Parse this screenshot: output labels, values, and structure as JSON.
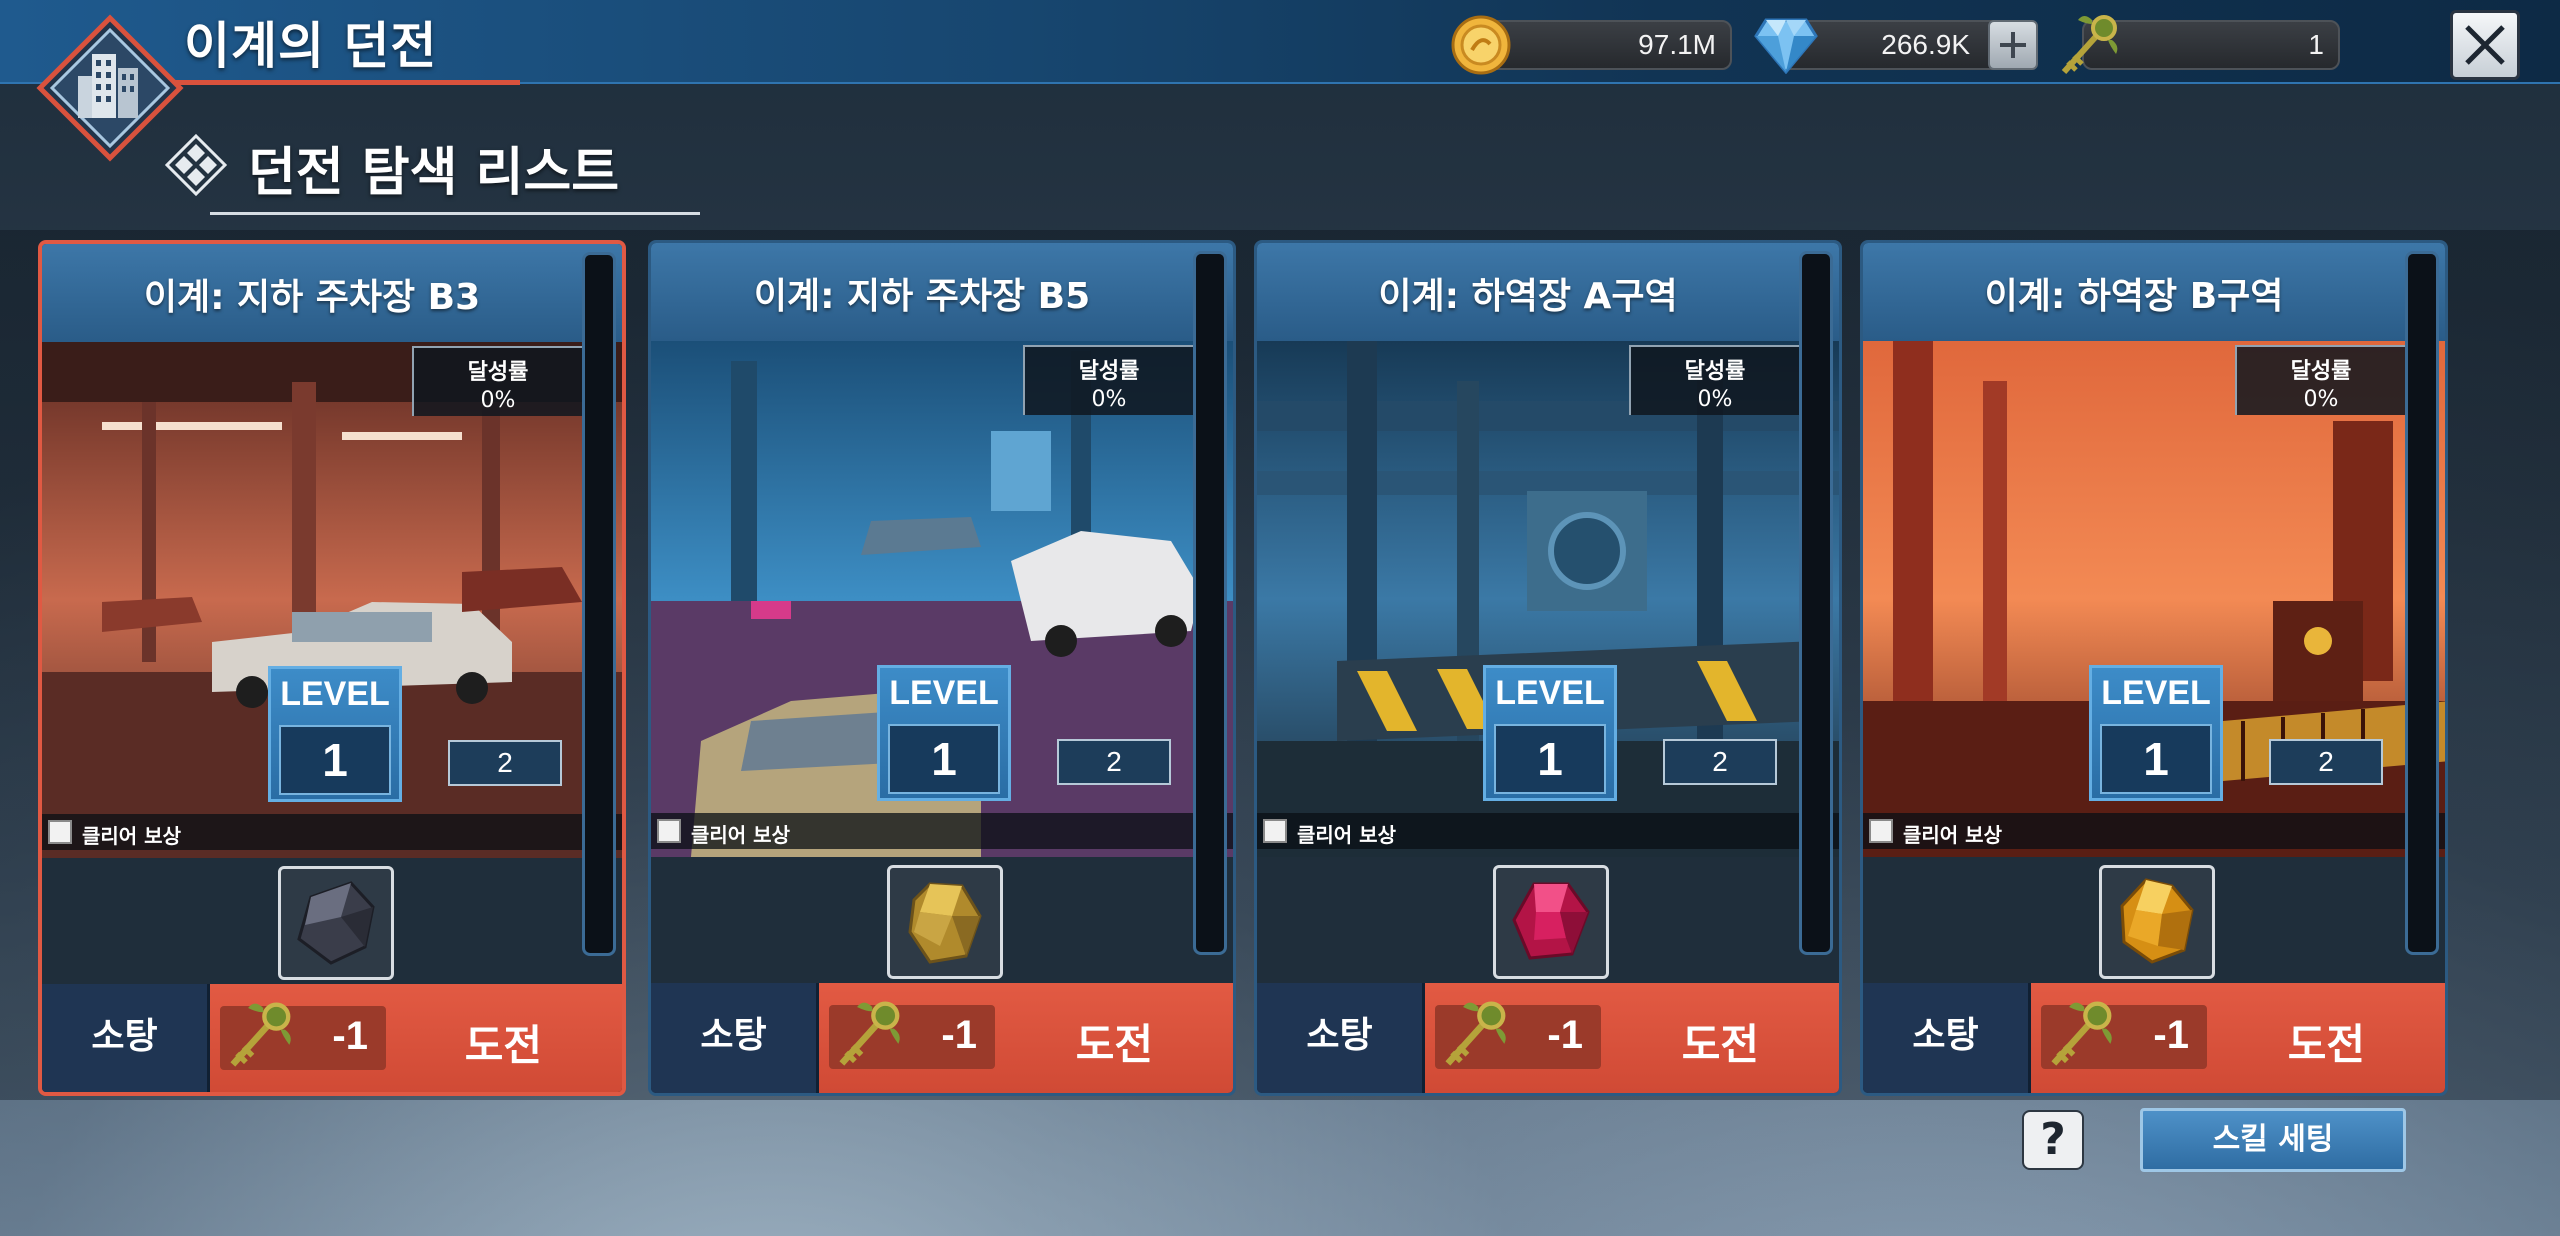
{
  "header": {
    "title": "이계의 던전",
    "subtitle": "던전 탐색 리스트"
  },
  "currencies": {
    "gold": "97.1M",
    "gems": "266.9K",
    "keys": "1"
  },
  "cards": [
    {
      "title": "이계: 지하 주차장 B3",
      "progress_label": "달성률",
      "progress_value": "0%",
      "level_label": "LEVEL",
      "level": "1",
      "next_level": "2",
      "reward_label": "클리어 보상",
      "sweep_label": "소탕",
      "cost": "-1",
      "challenge_label": "도전",
      "active": true,
      "item": "dark-ore"
    },
    {
      "title": "이계: 지하 주차장 B5",
      "progress_label": "달성률",
      "progress_value": "0%",
      "level_label": "LEVEL",
      "level": "1",
      "next_level": "2",
      "reward_label": "클리어 보상",
      "sweep_label": "소탕",
      "cost": "-1",
      "challenge_label": "도전",
      "active": false,
      "item": "gold-ore"
    },
    {
      "title": "이계: 하역장 A구역",
      "progress_label": "달성률",
      "progress_value": "0%",
      "level_label": "LEVEL",
      "level": "1",
      "next_level": "2",
      "reward_label": "클리어 보상",
      "sweep_label": "소탕",
      "cost": "-1",
      "challenge_label": "도전",
      "active": false,
      "item": "ruby-gem"
    },
    {
      "title": "이계: 하역장 B구역",
      "progress_label": "달성률",
      "progress_value": "0%",
      "level_label": "LEVEL",
      "level": "1",
      "next_level": "2",
      "reward_label": "클리어 보상",
      "sweep_label": "소탕",
      "cost": "-1",
      "challenge_label": "도전",
      "active": false,
      "item": "amber-gem"
    }
  ],
  "footer": {
    "help_label": "?",
    "skill_setting_label": "스킬 세팅"
  },
  "colors": {
    "accent_red": "#e05943",
    "header_blue": "#2a5c88",
    "dark_navy": "#1f3553"
  }
}
